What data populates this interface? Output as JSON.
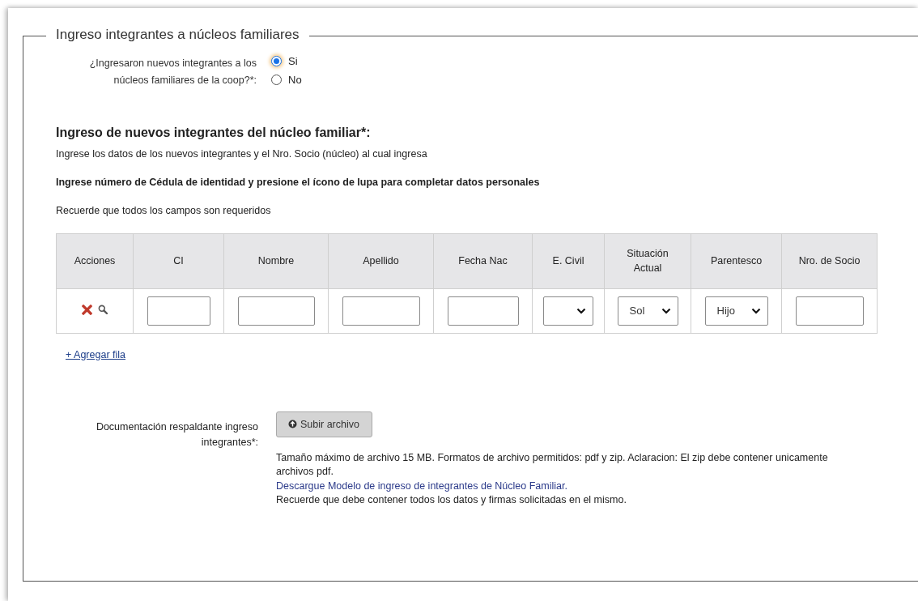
{
  "fieldset": {
    "legend": "Ingreso integrantes a núcleos familiares"
  },
  "question": {
    "label": "¿Ingresaron nuevos integrantes a los núcleos familiares de la coop?*:",
    "options": [
      {
        "label": "Si",
        "selected": true
      },
      {
        "label": "No",
        "selected": false
      }
    ]
  },
  "section": {
    "title": "Ingreso de nuevos integrantes del núcleo familiar*:",
    "instructions": [
      {
        "kind": "normal",
        "text": "Ingrese los datos de los nuevos integrantes y el Nro. Socio (núcleo) al cual ingresa"
      },
      {
        "kind": "bold",
        "text": "Ingrese número de Cédula de identidad y presione el ícono de lupa para completar datos personales"
      },
      {
        "kind": "normal",
        "text": "Recuerde que todos los campos son requeridos"
      }
    ]
  },
  "table": {
    "columns": [
      "Acciones",
      "CI",
      "Nombre",
      "Apellido",
      "Fecha Nac",
      "E. Civil",
      "Situación Actual",
      "Parentesco",
      "Nro. de Socio"
    ],
    "rows": [
      {
        "cells": [
          {
            "kind": "actions"
          },
          {
            "kind": "input"
          },
          {
            "kind": "input"
          },
          {
            "kind": "input"
          },
          {
            "kind": "input"
          },
          {
            "kind": "select"
          },
          {
            "kind": "select",
            "value": "Sol"
          },
          {
            "kind": "select",
            "value": "Hijo"
          },
          {
            "kind": "input"
          }
        ]
      }
    ]
  },
  "add_row_link": "+ Agregar fila",
  "upload": {
    "label": "Documentación respaldante ingreso integrantes*:",
    "button": "Subir archivo",
    "help": "Tamaño máximo de archivo 15 MB. Formatos de archivo permitidos: pdf y zip. Aclaracion: El zip debe contener unicamente archivos pdf.",
    "link": "Descargue Modelo de ingreso de integrantes de Núcleo Familiar.",
    "note": "Recuerde que debe contener todos los datos y firmas solicitadas en el mismo."
  }
}
